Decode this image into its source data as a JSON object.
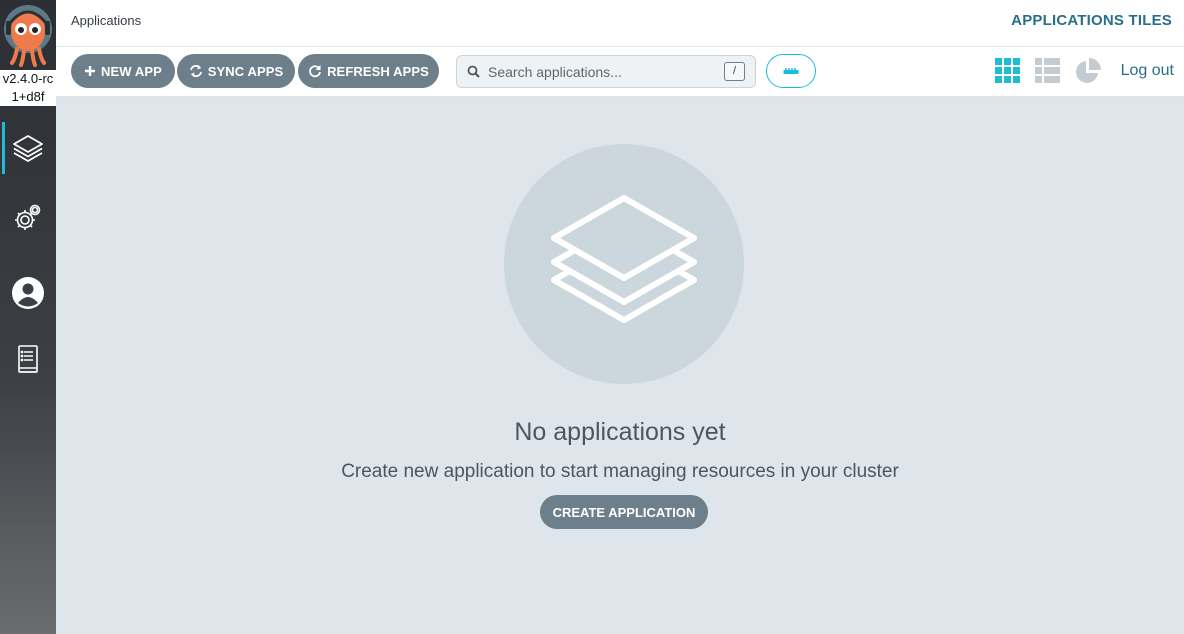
{
  "sidebar": {
    "version": "v2.4.0-rc1+d8f",
    "items": [
      {
        "name": "applications",
        "icon": "layers-icon",
        "active": true
      },
      {
        "name": "settings",
        "icon": "gears-icon",
        "active": false
      },
      {
        "name": "user-info",
        "icon": "user-circle-icon",
        "active": false
      },
      {
        "name": "documentation",
        "icon": "book-icon",
        "active": false
      }
    ]
  },
  "header": {
    "breadcrumb": "Applications",
    "view_title": "APPLICATIONS TILES"
  },
  "toolbar": {
    "new_app_label": "NEW APP",
    "sync_apps_label": "SYNC APPS",
    "refresh_apps_label": "REFRESH APPS",
    "search_placeholder": "Search applications...",
    "search_shortcut": "/",
    "filter_icon": "ruler-icon",
    "view_modes": [
      "tiles-view-icon",
      "list-view-icon",
      "pie-chart-icon"
    ],
    "active_view": "tiles",
    "logout_label": "Log out"
  },
  "empty_state": {
    "icon": "layers-icon",
    "title": "No applications yet",
    "subtitle": "Create new application to start managing resources in your cluster",
    "button_label": "CREATE APPLICATION"
  },
  "colors": {
    "accent": "#1fbcd6",
    "button": "#6d7f8b",
    "link": "#2a6f8a",
    "background": "#dee6eb"
  }
}
